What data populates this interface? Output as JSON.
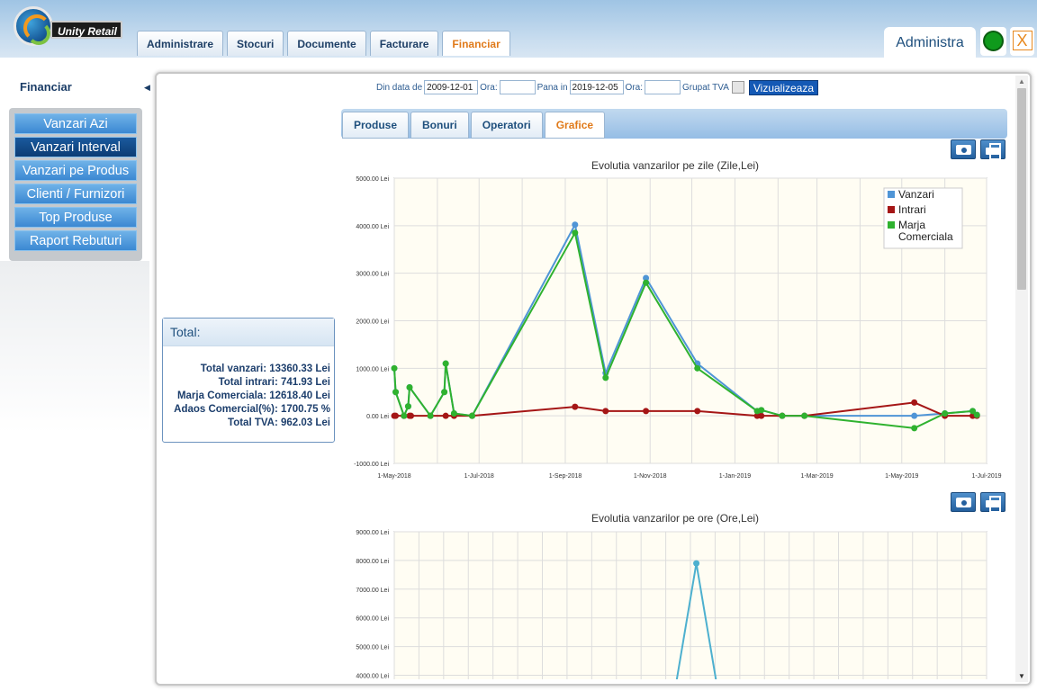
{
  "app": {
    "logo_text": "Unity Retail"
  },
  "main_tabs": [
    {
      "label": "Administrare"
    },
    {
      "label": "Stocuri"
    },
    {
      "label": "Documente"
    },
    {
      "label": "Facturare"
    },
    {
      "label": "Financiar",
      "active": true
    }
  ],
  "user_tab": {
    "label": "Administra"
  },
  "close_label": "X",
  "sidebar": {
    "title": "Financiar",
    "items": [
      {
        "label": "Vanzari Azi"
      },
      {
        "label": "Vanzari Interval",
        "active": true
      },
      {
        "label": "Vanzari pe Produs"
      },
      {
        "label": "Clienti / Furnizori"
      },
      {
        "label": "Top Produse"
      },
      {
        "label": "Raport Rebuturi"
      }
    ]
  },
  "filters": {
    "from_label": "Din data de",
    "from_value": "2009-12-01",
    "hour_label": "Ora:",
    "from_hour": "",
    "to_label": "Pana in",
    "to_value": "2019-12-05",
    "to_hour": "",
    "group_tva_label": "Grupat TVA",
    "show_button": "Vizualizeaza"
  },
  "sub_tabs": [
    {
      "label": "Produse"
    },
    {
      "label": "Bonuri"
    },
    {
      "label": "Operatori"
    },
    {
      "label": "Grafice",
      "active": true
    }
  ],
  "totals": {
    "title": "Total:",
    "lines": [
      "Total vanzari: 13360.33 Lei",
      "Total intrari: 741.93 Lei",
      "Marja Comerciala: 12618.40 Lei",
      "Adaos Comercial(%): 1700.75 %",
      "Total TVA: 962.03 Lei"
    ]
  },
  "colors": {
    "vanzari": "#4f95d6",
    "intrari": "#a51616",
    "marja": "#2fb22f",
    "ore": "#4db0cf"
  },
  "chart_data": [
    {
      "type": "line",
      "title": "Evolutia vanzarilor pe zile (Zile,Lei)",
      "x_ticks": [
        "1-May-2018",
        "1-Jul-2018",
        "1-Sep-2018",
        "1-Nov-2018",
        "1-Jan-2019",
        "1-Mar-2019",
        "1-May-2019",
        "1-Jul-2019"
      ],
      "y_ticks": [
        "5000.00 Lei",
        "4000.00 Lei",
        "3000.00 Lei",
        "2000.00 Lei",
        "1000.00 Lei",
        "0.00 Lei",
        "-1000.00 Lei"
      ],
      "ylim": [
        -1000,
        5000
      ],
      "xlim": [
        "2018-05-01",
        "2019-07-01"
      ],
      "legend": "top-right",
      "legend_entries": [
        "Vanzari",
        "Intrari",
        "Marja\nComerciala"
      ],
      "series": [
        {
          "name": "Vanzari",
          "points": [
            [
              "2018-05-01",
              1000
            ],
            [
              "2018-05-02",
              500
            ],
            [
              "2018-05-08",
              0
            ],
            [
              "2018-05-11",
              200
            ],
            [
              "2018-05-12",
              600
            ],
            [
              "2018-05-27",
              0
            ],
            [
              "2018-06-06",
              500
            ],
            [
              "2018-06-07",
              1100
            ],
            [
              "2018-06-13",
              50
            ],
            [
              "2018-06-26",
              0
            ],
            [
              "2018-09-08",
              4020
            ],
            [
              "2018-09-30",
              900
            ],
            [
              "2018-10-29",
              2900
            ],
            [
              "2018-12-05",
              1100
            ],
            [
              "2019-01-17",
              100
            ],
            [
              "2019-01-20",
              120
            ],
            [
              "2019-02-04",
              0
            ],
            [
              "2019-02-20",
              0
            ],
            [
              "2019-05-10",
              0
            ],
            [
              "2019-06-01",
              50
            ],
            [
              "2019-06-21",
              100
            ],
            [
              "2019-06-24",
              20
            ]
          ]
        },
        {
          "name": "Intrari",
          "points": [
            [
              "2018-05-01",
              0
            ],
            [
              "2018-05-02",
              0
            ],
            [
              "2018-05-08",
              0
            ],
            [
              "2018-05-12",
              0
            ],
            [
              "2018-05-13",
              0
            ],
            [
              "2018-05-27",
              0
            ],
            [
              "2018-06-07",
              0
            ],
            [
              "2018-06-13",
              0
            ],
            [
              "2018-06-26",
              0
            ],
            [
              "2018-09-08",
              190
            ],
            [
              "2018-09-30",
              100
            ],
            [
              "2018-10-29",
              100
            ],
            [
              "2018-12-05",
              100
            ],
            [
              "2019-01-17",
              0
            ],
            [
              "2019-01-20",
              0
            ],
            [
              "2019-02-04",
              0
            ],
            [
              "2019-02-20",
              0
            ],
            [
              "2019-05-10",
              280
            ],
            [
              "2019-06-01",
              0
            ],
            [
              "2019-06-21",
              0
            ],
            [
              "2019-06-24",
              0
            ]
          ]
        },
        {
          "name": "Marja Comerciala",
          "points": [
            [
              "2018-05-01",
              1000
            ],
            [
              "2018-05-02",
              500
            ],
            [
              "2018-05-08",
              0
            ],
            [
              "2018-05-11",
              200
            ],
            [
              "2018-05-12",
              600
            ],
            [
              "2018-05-27",
              0
            ],
            [
              "2018-06-06",
              500
            ],
            [
              "2018-06-07",
              1100
            ],
            [
              "2018-06-13",
              50
            ],
            [
              "2018-06-26",
              0
            ],
            [
              "2018-09-08",
              3850
            ],
            [
              "2018-09-30",
              800
            ],
            [
              "2018-10-29",
              2800
            ],
            [
              "2018-12-05",
              1000
            ],
            [
              "2019-01-17",
              100
            ],
            [
              "2019-01-20",
              120
            ],
            [
              "2019-02-04",
              0
            ],
            [
              "2019-02-20",
              0
            ],
            [
              "2019-05-10",
              -260
            ],
            [
              "2019-06-01",
              50
            ],
            [
              "2019-06-21",
              100
            ],
            [
              "2019-06-24",
              20
            ]
          ]
        }
      ]
    },
    {
      "type": "line",
      "title": "Evolutia vanzarilor pe ore (Ore,Lei)",
      "y_ticks": [
        "9000.00 Lei",
        "8000.00 Lei",
        "7000.00 Lei",
        "6000.00 Lei",
        "5000.00 Lei",
        "4000.00 Lei"
      ],
      "ylim": [
        4000,
        9000
      ],
      "series": [
        {
          "name": "Vanzari",
          "points": [
            [
              0.47,
              3000
            ],
            [
              0.51,
              7900
            ],
            [
              0.55,
              3000
            ]
          ]
        }
      ]
    }
  ]
}
